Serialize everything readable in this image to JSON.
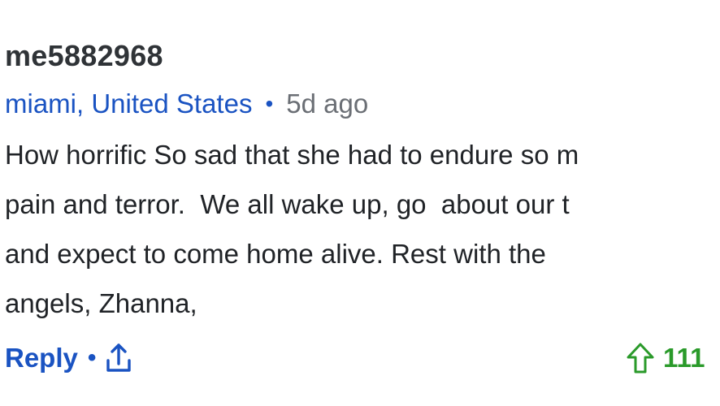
{
  "comment": {
    "username": "me5882968",
    "location": "miami, United States",
    "separator": "•",
    "time": "5d ago",
    "body_lines": [
      "How horrific So sad that she had to endure so m",
      "pain and terror.  We all wake up, go  about our t",
      "and expect to come home alive. Rest with the",
      "angels, Zhanna,"
    ],
    "actions": {
      "reply_label": "Reply",
      "separator": "•",
      "share_icon": "share-upload-icon"
    },
    "votes": {
      "upvote_icon": "upvote-arrow-icon",
      "count": "111"
    },
    "colors": {
      "username": "#2f3337",
      "link": "#1a53c2",
      "meta": "#6b6f75",
      "body": "#202327",
      "vote": "#2a9a2a"
    }
  }
}
